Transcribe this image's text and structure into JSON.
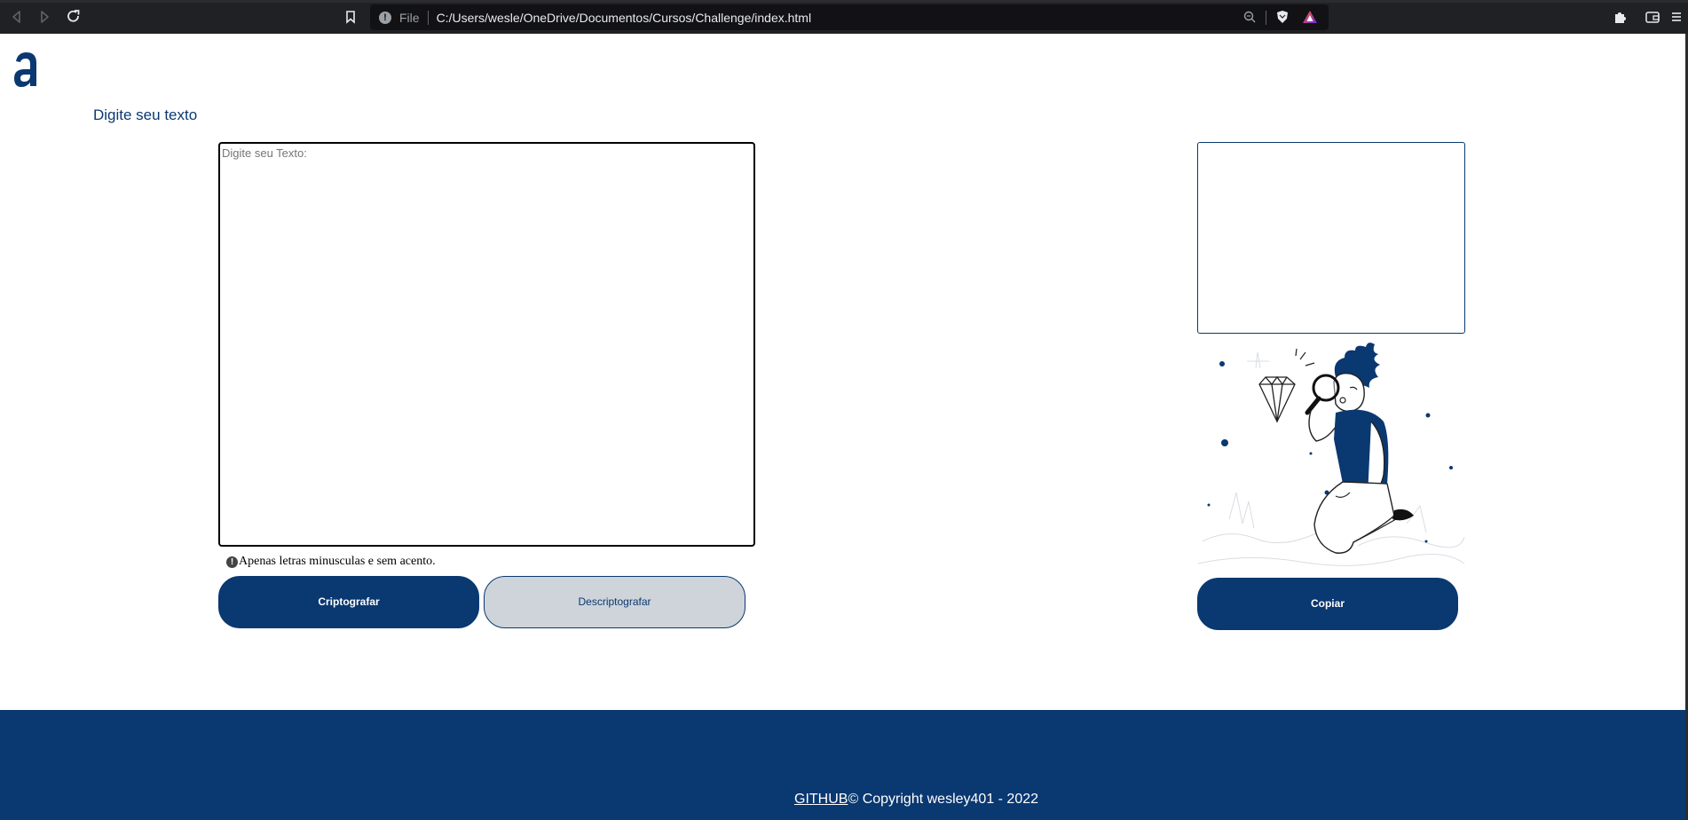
{
  "browser": {
    "scheme_label": "File",
    "url": "C:/Users/wesle/OneDrive/Documentos/Cursos/Challenge/index.html"
  },
  "page": {
    "prompt_title": "Digite seu texto",
    "input_placeholder": "Digite seu Texto:",
    "warning_text": "Apenas letras minusculas e sem acento.",
    "encrypt_label": "Criptografar",
    "decrypt_label": "Descriptografar",
    "copy_label": "Copiar"
  },
  "footer": {
    "github_link": "GITHUB",
    "copyright": "© Copyright wesley401 - 2022"
  },
  "colors": {
    "brand": "#0a3871",
    "secondary_button": "#ced4da",
    "chrome": "#202124"
  },
  "icons": [
    "back-arrow-icon",
    "forward-arrow-icon",
    "reload-icon",
    "bookmark-icon",
    "info-icon",
    "zoom-icon",
    "brave-shield-icon",
    "brave-rewards-icon",
    "extensions-icon",
    "wallet-icon",
    "menu-icon",
    "alura-logo",
    "warning-icon"
  ]
}
